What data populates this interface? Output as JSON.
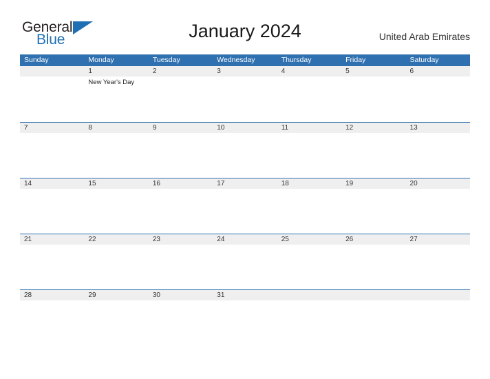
{
  "brand": {
    "name_part1": "General",
    "name_part2": "Blue",
    "triangle_icon": "triangle-icon",
    "colors": {
      "dark": "#231f20",
      "blue": "#1f6fb4"
    }
  },
  "header": {
    "title": "January 2024",
    "country": "United Arab Emirates"
  },
  "theme": {
    "header_blue": "#2e70b0",
    "band_gray": "#efefef",
    "rule_blue": "#2e70b0",
    "page_bg": "#ffffff"
  },
  "calendar": {
    "month": "January",
    "year": "2024",
    "weekday_headers": [
      "Sunday",
      "Monday",
      "Tuesday",
      "Wednesday",
      "Thursday",
      "Friday",
      "Saturday"
    ],
    "weeks": [
      {
        "days": [
          {
            "number": "",
            "events": []
          },
          {
            "number": "1",
            "events": [
              "New Year's Day"
            ]
          },
          {
            "number": "2",
            "events": []
          },
          {
            "number": "3",
            "events": []
          },
          {
            "number": "4",
            "events": []
          },
          {
            "number": "5",
            "events": []
          },
          {
            "number": "6",
            "events": []
          }
        ]
      },
      {
        "days": [
          {
            "number": "7",
            "events": []
          },
          {
            "number": "8",
            "events": []
          },
          {
            "number": "9",
            "events": []
          },
          {
            "number": "10",
            "events": []
          },
          {
            "number": "11",
            "events": []
          },
          {
            "number": "12",
            "events": []
          },
          {
            "number": "13",
            "events": []
          }
        ]
      },
      {
        "days": [
          {
            "number": "14",
            "events": []
          },
          {
            "number": "15",
            "events": []
          },
          {
            "number": "16",
            "events": []
          },
          {
            "number": "17",
            "events": []
          },
          {
            "number": "18",
            "events": []
          },
          {
            "number": "19",
            "events": []
          },
          {
            "number": "20",
            "events": []
          }
        ]
      },
      {
        "days": [
          {
            "number": "21",
            "events": []
          },
          {
            "number": "22",
            "events": []
          },
          {
            "number": "23",
            "events": []
          },
          {
            "number": "24",
            "events": []
          },
          {
            "number": "25",
            "events": []
          },
          {
            "number": "26",
            "events": []
          },
          {
            "number": "27",
            "events": []
          }
        ]
      },
      {
        "days": [
          {
            "number": "28",
            "events": []
          },
          {
            "number": "29",
            "events": []
          },
          {
            "number": "30",
            "events": []
          },
          {
            "number": "31",
            "events": []
          },
          {
            "number": "",
            "events": []
          },
          {
            "number": "",
            "events": []
          },
          {
            "number": "",
            "events": []
          }
        ]
      }
    ]
  }
}
